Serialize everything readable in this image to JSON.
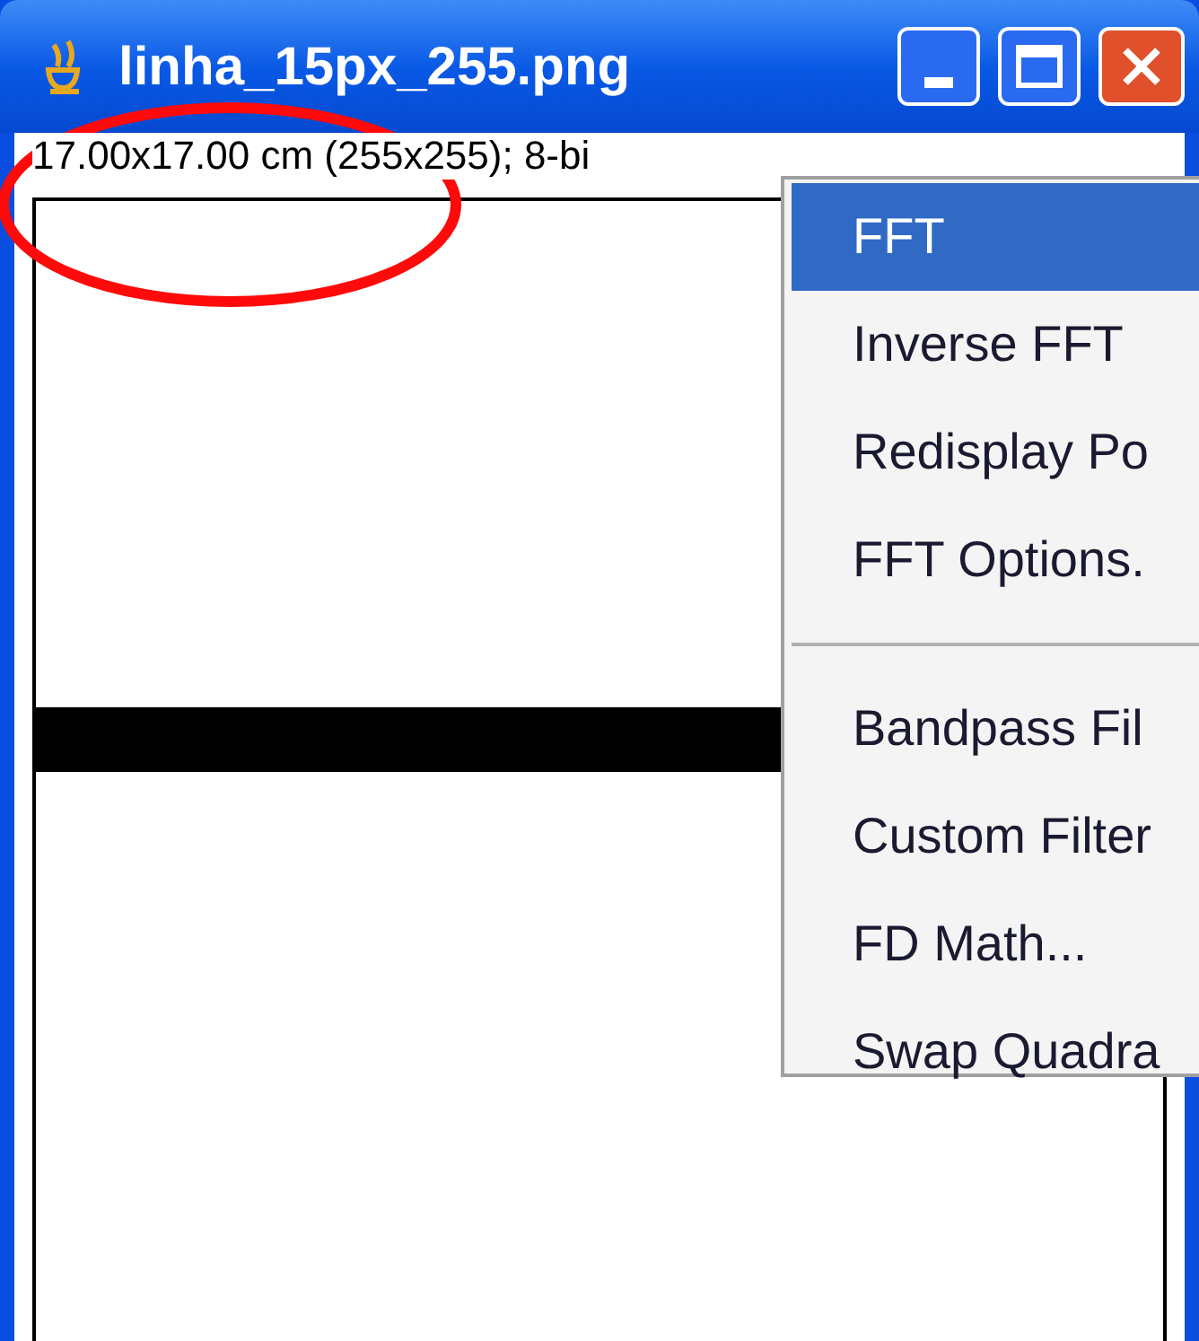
{
  "window": {
    "title": "linha_15px_255.png",
    "info": "17.00x17.00 cm (255x255); 8-bi"
  },
  "menu": {
    "items": [
      {
        "kind": "item",
        "label": "FFT",
        "selected": true
      },
      {
        "kind": "item",
        "label": "Inverse FFT",
        "selected": false
      },
      {
        "kind": "item",
        "label": "Redisplay Po",
        "selected": false
      },
      {
        "kind": "item",
        "label": "FFT Options.",
        "selected": false
      },
      {
        "kind": "separator"
      },
      {
        "kind": "item",
        "label": "Bandpass Fil",
        "selected": false
      },
      {
        "kind": "item",
        "label": "Custom Filter",
        "selected": false
      },
      {
        "kind": "item",
        "label": "FD Math...",
        "selected": false
      },
      {
        "kind": "item",
        "label": "Swap Quadra",
        "selected": false
      }
    ]
  }
}
